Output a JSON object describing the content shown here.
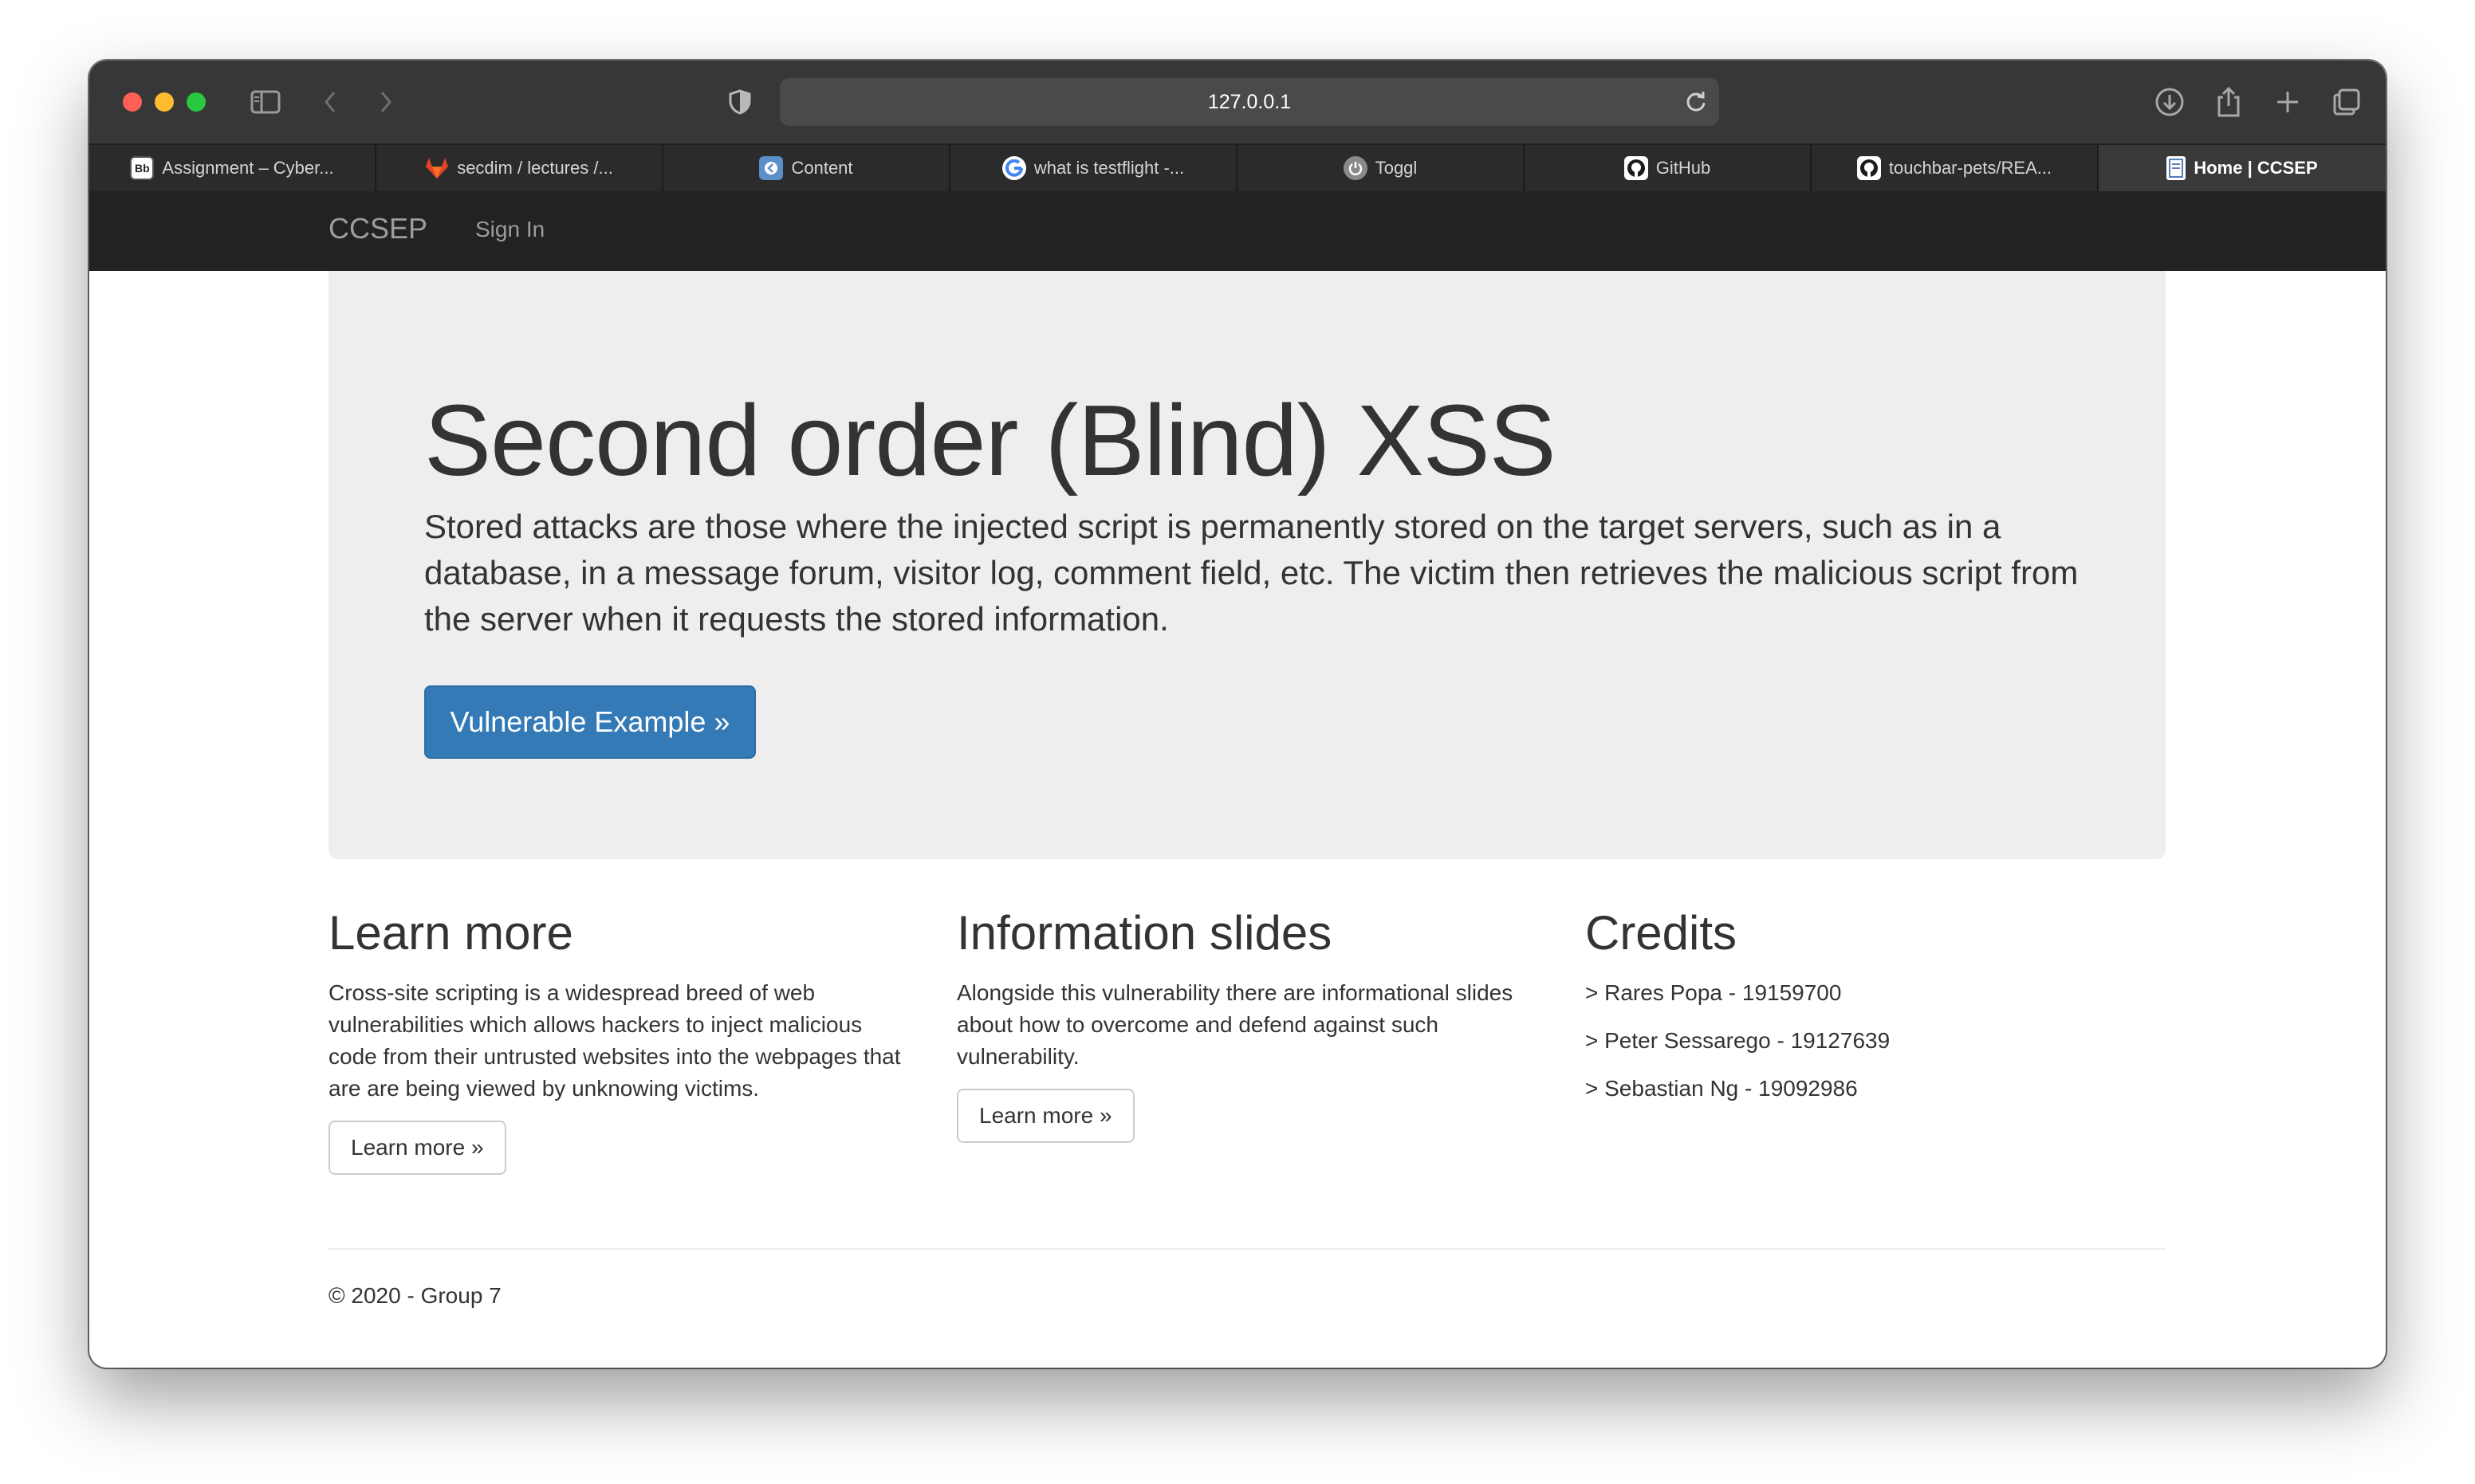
{
  "browser": {
    "url": "127.0.0.1",
    "tabs": [
      {
        "title": "Assignment – Cyber...",
        "icon": "blackboard-icon"
      },
      {
        "title": "secdim / lectures /...",
        "icon": "gitlab-icon"
      },
      {
        "title": "Content",
        "icon": "content-icon"
      },
      {
        "title": "what is testflight -...",
        "icon": "google-icon"
      },
      {
        "title": "Toggl",
        "icon": "toggl-icon"
      },
      {
        "title": "GitHub",
        "icon": "github-icon"
      },
      {
        "title": "touchbar-pets/REA...",
        "icon": "github-icon"
      },
      {
        "title": "Home | CCSEP",
        "icon": "page-icon"
      }
    ]
  },
  "site": {
    "brand": "CCSEP",
    "nav_signin": "Sign In",
    "hero": {
      "title": "Second order (Blind) XSS",
      "text": "Stored attacks are those where the injected script is permanently stored on the target servers, such as in a database, in a message forum, visitor log, comment field, etc. The victim then retrieves the malicious script from the server when it requests the stored information.",
      "button": "Vulnerable Example »"
    },
    "learn_more": {
      "heading": "Learn more",
      "text": "Cross-site scripting is a widespread breed of web vulnerabilities which allows hackers to inject malicious code from their untrusted websites into the webpages that are are being viewed by unknowing victims.",
      "button": "Learn more »"
    },
    "slides": {
      "heading": "Information slides",
      "text": "Alongside this vulnerability there are informational slides about how to overcome and defend against such vulnerability.",
      "button": "Learn more »"
    },
    "credits": {
      "heading": "Credits",
      "items": [
        "> Rares Popa - 19159700",
        "> Peter Sessarego - 19127639",
        "> Sebastian Ng - 19092986"
      ]
    },
    "footer": "© 2020 - Group 7"
  },
  "colors": {
    "navbar": "#222222",
    "jumbotron": "#eeeeee",
    "primary": "#337ab7",
    "text": "#333333"
  }
}
